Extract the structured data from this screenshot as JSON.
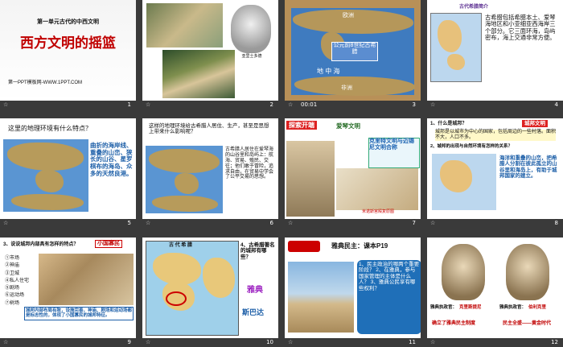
{
  "slides": [
    {
      "number": "1",
      "subtitle": "第一单元古代的中西文明",
      "title": "西方文明的摇篮",
      "footer": "第一PPT模板网-WWW.1PPT.COM"
    },
    {
      "number": "2",
      "caption": "亚里士多德"
    },
    {
      "number": "3",
      "time": "00:01",
      "map_label": "公元前8世纪古希腊",
      "top_label": "欧洲",
      "sea_label": "地 中 海",
      "bottom_label": "非洲"
    },
    {
      "number": "4",
      "header": "古代希腊简介",
      "body": "古希腊包括希腊本土、爱琴海地区和小亚细亚西海岸三个部分。它三面环海，岛屿密布，海上交通非常方便。"
    },
    {
      "number": "5",
      "question": "这里的地理环境有什么特点？",
      "answer": "曲折的海岸线、重叠的山峦、狭长的山谷、星罗棋布的海岛、众多的天然良港。"
    },
    {
      "number": "6",
      "question": "这样的地理环境给古希腊人居住、生产，甚至是思想上带来什么影响呢？",
      "answer": "古希腊人居住在爱琴海的山谷里和岛屿上：航海、贸易、殖民、交往；他们敢于冒险，追求自由，在贸易中学会了公平交易的思想。"
    },
    {
      "number": "7",
      "tag": "探索开端",
      "title": "爱琴文明",
      "bubble": "克里特文明与迈锡尼文明合称",
      "caption": "米诺斯宫殿复原图"
    },
    {
      "number": "8",
      "tag": "城邦文明",
      "q1": "1、什么是城邦？",
      "a1": "城邦是以城市为中心的国家，包括周边的一些村落。面积不大，人口不多。",
      "q2": "2、城邦的出现与自然环境有怎样的关系？",
      "a2": "海洋和重叠的山峦，把希腊人分割在彼此孤立的山谷里和海岛上，有助于城邦国家的建立。"
    },
    {
      "number": "9",
      "question": "3、说说城邦内部具有怎样的特点？",
      "tag": "小国寡民",
      "items": [
        "①市场",
        "②神庙",
        "③卫城",
        "④私人住宅",
        "⑤剧场",
        "⑥运动场",
        "⑦树场"
      ],
      "summary": "城邦内部布局有致，设施完善，神庙、剧场和运动场都是标志性的，体现了小国寡民的城邦特征。"
    },
    {
      "number": "10",
      "map_title": "古 代 希 腊",
      "question": "4、古希腊著名的城邦有哪些？",
      "ans1": "雅典",
      "ans2": "斯巴达"
    },
    {
      "number": "11",
      "title": "雅典民主：课本P19",
      "qs": "1、民主政治的哪两个重要阶段？ 2、在雅典，参与国家管理的主体是什么人？ 3、雅典公民享有哪些权利？"
    },
    {
      "number": "12",
      "left_label": "雅典执政官：",
      "left_name": "克里斯提尼",
      "right_label": "雅典执政官：",
      "right_name": "伯利克里",
      "left_caption": "确立了雅典民主制度",
      "right_caption": "民主全盛——黄金时代"
    }
  ],
  "colors": {
    "accent_red": "#c00000",
    "bg": "#3a3a3a",
    "sea": "#4a86c9"
  }
}
